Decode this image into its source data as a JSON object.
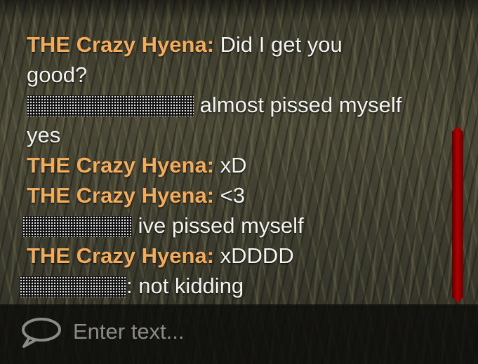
{
  "chat": {
    "messages": [
      {
        "sender": "THE Crazy Hyena:",
        "text": "Did I get you"
      },
      {
        "sender": "",
        "text": "good?"
      },
      {
        "sender": "",
        "text": "almost pissed myself",
        "redacted": true
      },
      {
        "sender": "",
        "text": "yes"
      },
      {
        "sender": "THE Crazy Hyena:",
        "text": "xD"
      },
      {
        "sender": "THE Crazy Hyena:",
        "text": "<3"
      },
      {
        "sender": "",
        "text": "ive pissed myself",
        "redacted": true
      },
      {
        "sender": "THE Crazy Hyena:",
        "text": "xDDDD"
      },
      {
        "sender": "",
        "text": ": not kidding",
        "redacted": true
      }
    ]
  },
  "input": {
    "placeholder": "Enter text...",
    "icon": "speech-bubble-icon"
  },
  "colors": {
    "sender": "#f2ad5c",
    "message": "#f4f4f0",
    "scrollbar": "#b00000",
    "placeholder": "#8a8a86"
  }
}
